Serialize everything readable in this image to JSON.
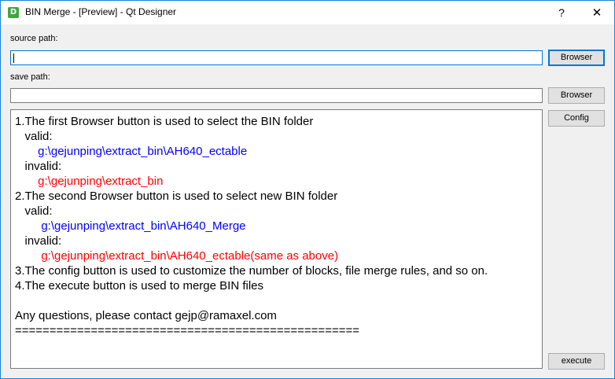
{
  "window": {
    "title": "BIN Merge - [Preview] - Qt Designer",
    "app_icon_letter": "D",
    "help_glyph": "?",
    "close_glyph": "✕"
  },
  "form": {
    "source_label": "source path:",
    "source_value": "",
    "source_browse": "Browser",
    "save_label": "save path:",
    "save_value": "",
    "save_browse": "Browser",
    "config_button": "Config",
    "execute_button": "execute"
  },
  "info_text": {
    "lines": [
      {
        "text": "1.The first Browser button is used to select the BIN folder",
        "color": "black"
      },
      {
        "text": "   valid:",
        "color": "black"
      },
      {
        "text": "       g:\\gejunping\\extract_bin\\AH640_ectable",
        "color": "blue"
      },
      {
        "text": "   invalid:",
        "color": "black"
      },
      {
        "text": "       g:\\gejunping\\extract_bin",
        "color": "red"
      },
      {
        "text": "2.The second Browser button is used to select new BIN folder",
        "color": "black"
      },
      {
        "text": "   valid:",
        "color": "black"
      },
      {
        "text": "        g:\\gejunping\\extract_bin\\AH640_Merge",
        "color": "blue"
      },
      {
        "text": "   invalid:",
        "color": "black"
      },
      {
        "text": "        g:\\gejunping\\extract_bin\\AH640_ectable(same as above)",
        "color": "red"
      },
      {
        "text": "3.The config button is used to customize the number of blocks, file merge rules, and so on.",
        "color": "black"
      },
      {
        "text": "4.The execute button is used to merge BIN files",
        "color": "black"
      },
      {
        "text": "",
        "color": "black"
      },
      {
        "text": "Any questions, please contact gejp@ramaxel.com",
        "color": "black"
      },
      {
        "text": "==================================================",
        "color": "black"
      }
    ]
  }
}
